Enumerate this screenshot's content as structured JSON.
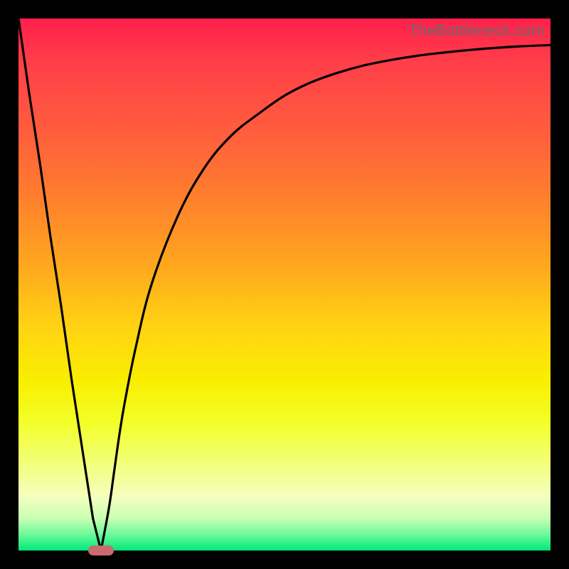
{
  "attribution": "TheBottleneck.com",
  "chart_data": {
    "type": "line",
    "title": "",
    "xlabel": "",
    "ylabel": "",
    "xlim": [
      0,
      100
    ],
    "ylim": [
      0,
      100
    ],
    "x": [
      0,
      2,
      4,
      6,
      8,
      10,
      12,
      14,
      15.5,
      17,
      18,
      19,
      20,
      22,
      25,
      30,
      35,
      40,
      45,
      50,
      55,
      60,
      65,
      70,
      75,
      80,
      85,
      90,
      95,
      100
    ],
    "values": [
      100,
      86,
      73,
      59,
      46,
      32,
      19,
      6,
      0,
      8,
      15,
      22,
      28,
      38,
      50,
      63,
      72,
      78,
      82,
      85.5,
      88,
      89.8,
      91.2,
      92.2,
      93,
      93.6,
      94.1,
      94.5,
      94.8,
      95
    ],
    "optimum_x": 15.5,
    "marker": {
      "x": 15.5,
      "y": 0,
      "color": "#cb6a6f"
    }
  },
  "colors": {
    "frame": "#000000",
    "gradient_top": "#ff1f4b",
    "gradient_bottom": "#00e87a",
    "curve": "#000000",
    "marker": "#cb6a6f",
    "attribution_text": "#6a6a6a"
  }
}
